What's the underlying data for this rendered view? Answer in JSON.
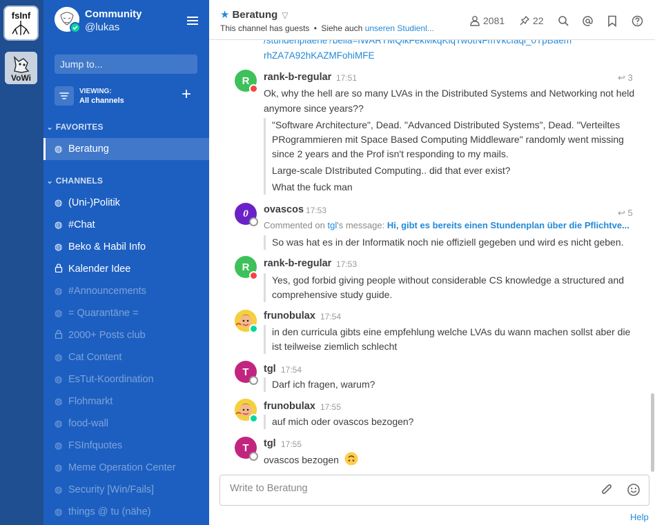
{
  "teams": [
    {
      "label": "fsInf"
    },
    {
      "label": "VoWi"
    }
  ],
  "sidebar": {
    "team_name": "Community",
    "user_name": "@lukas",
    "jump_placeholder": "Jump to...",
    "viewing_label": "VIEWING:",
    "viewing_value": "All channels",
    "favorites_header": "FAVORITES",
    "favorites": [
      {
        "label": "Beratung",
        "icon": "globe-icon",
        "active": true
      }
    ],
    "channels_header": "CHANNELS",
    "channels": [
      {
        "label": "(Uni-)Politik",
        "icon": "globe-icon",
        "dim": false
      },
      {
        "label": "#Chat",
        "icon": "globe-icon",
        "dim": false
      },
      {
        "label": "Beko & Habil Info",
        "icon": "globe-icon",
        "dim": false
      },
      {
        "label": "Kalender Idee",
        "icon": "lock-icon",
        "dim": false
      },
      {
        "label": "#Announcements",
        "icon": "globe-icon",
        "dim": true
      },
      {
        "label": "= Quarantäne =",
        "icon": "globe-icon",
        "dim": true
      },
      {
        "label": "2000+ Posts club",
        "icon": "lock-icon",
        "dim": true
      },
      {
        "label": "Cat Content",
        "icon": "globe-icon",
        "dim": true
      },
      {
        "label": "EsTut-Koordination",
        "icon": "globe-icon",
        "dim": true
      },
      {
        "label": "Flohmarkt",
        "icon": "globe-icon",
        "dim": true
      },
      {
        "label": "food-wall",
        "icon": "globe-icon",
        "dim": true
      },
      {
        "label": "FSInfquotes",
        "icon": "globe-icon",
        "dim": true
      },
      {
        "label": "Meme Operation Center",
        "icon": "globe-icon",
        "dim": true
      },
      {
        "label": "Security [Win/Fails]",
        "icon": "globe-icon",
        "dim": true
      },
      {
        "label": "things @ tu (nähe)",
        "icon": "globe-icon",
        "dim": true
      }
    ]
  },
  "header": {
    "channel_name": "Beratung",
    "guests_text": "This channel has guests",
    "separator": "•",
    "see_also": "Siehe auch",
    "see_also_link": "unseren Studienl...",
    "members_count": "2081",
    "pinned_count": "22"
  },
  "messages": {
    "link_line_1": "/stundenplaene?bella=fWARTMQlkFekMkqKiqTwotNFmVkcIaqi_0TpBaem",
    "link_line_2": "rhZA7A92hKAZMFohiMFE",
    "items": [
      {
        "author": "rank-b-regular",
        "time": "17:51",
        "reply_count": "3",
        "avatar_letter": "R",
        "text": "Ok, why the hell are so many LVAs in the Distributed Systems and Networking not held anymore since years??",
        "quote_lines": [
          "\"Software Architecture\", Dead. \"Advanced Distributed Systems\", Dead. \"Verteiltes PRogrammieren mit Space Based Computing Middleware\" randomly went missing since 2 years and the Prof isn't responding to my mails.",
          "Large-scale DIstributed Computing.. did that ever exist?",
          "What the fuck man"
        ]
      },
      {
        "author": "ovascos",
        "time": "17:53",
        "reply_count": "5",
        "avatar_letter": "0",
        "comment_prefix": "Commented on",
        "comment_user": "tgl",
        "comment_mid": "'s message:",
        "comment_quote": "Hi, gibt es bereits einen Stundenplan über die Pflichtve...",
        "text": "So was hat es in der Informatik noch nie offiziell gegeben und wird es nicht geben."
      },
      {
        "author": "rank-b-regular",
        "time": "17:53",
        "avatar_letter": "R",
        "text": "Yes, god forbid giving people without considerable CS knowledge a structured and comprehensive study guide."
      },
      {
        "author": "frunobulax",
        "time": "17:54",
        "text": "in den curricula gibts eine empfehlung welche LVAs du wann machen sollst aber die ist teilweise ziemlich schlecht"
      },
      {
        "author": "tgl",
        "time": "17:54",
        "avatar_letter": "T",
        "text": "Darf ich fragen, warum?"
      },
      {
        "author": "frunobulax",
        "time": "17:55",
        "text": "auf mich oder ovascos bezogen?"
      },
      {
        "author": "tgl",
        "time": "17:55",
        "avatar_letter": "T",
        "text": "ovascos bezogen"
      }
    ]
  },
  "composer": {
    "placeholder": "Write to Beratung"
  },
  "footer": {
    "help": "Help"
  },
  "colors": {
    "team_sidebar": "#1f4e91",
    "sidebar": "#1d5fc0",
    "link": "#2389d7",
    "online": "#06d6a0",
    "dnd": "#f74343"
  }
}
